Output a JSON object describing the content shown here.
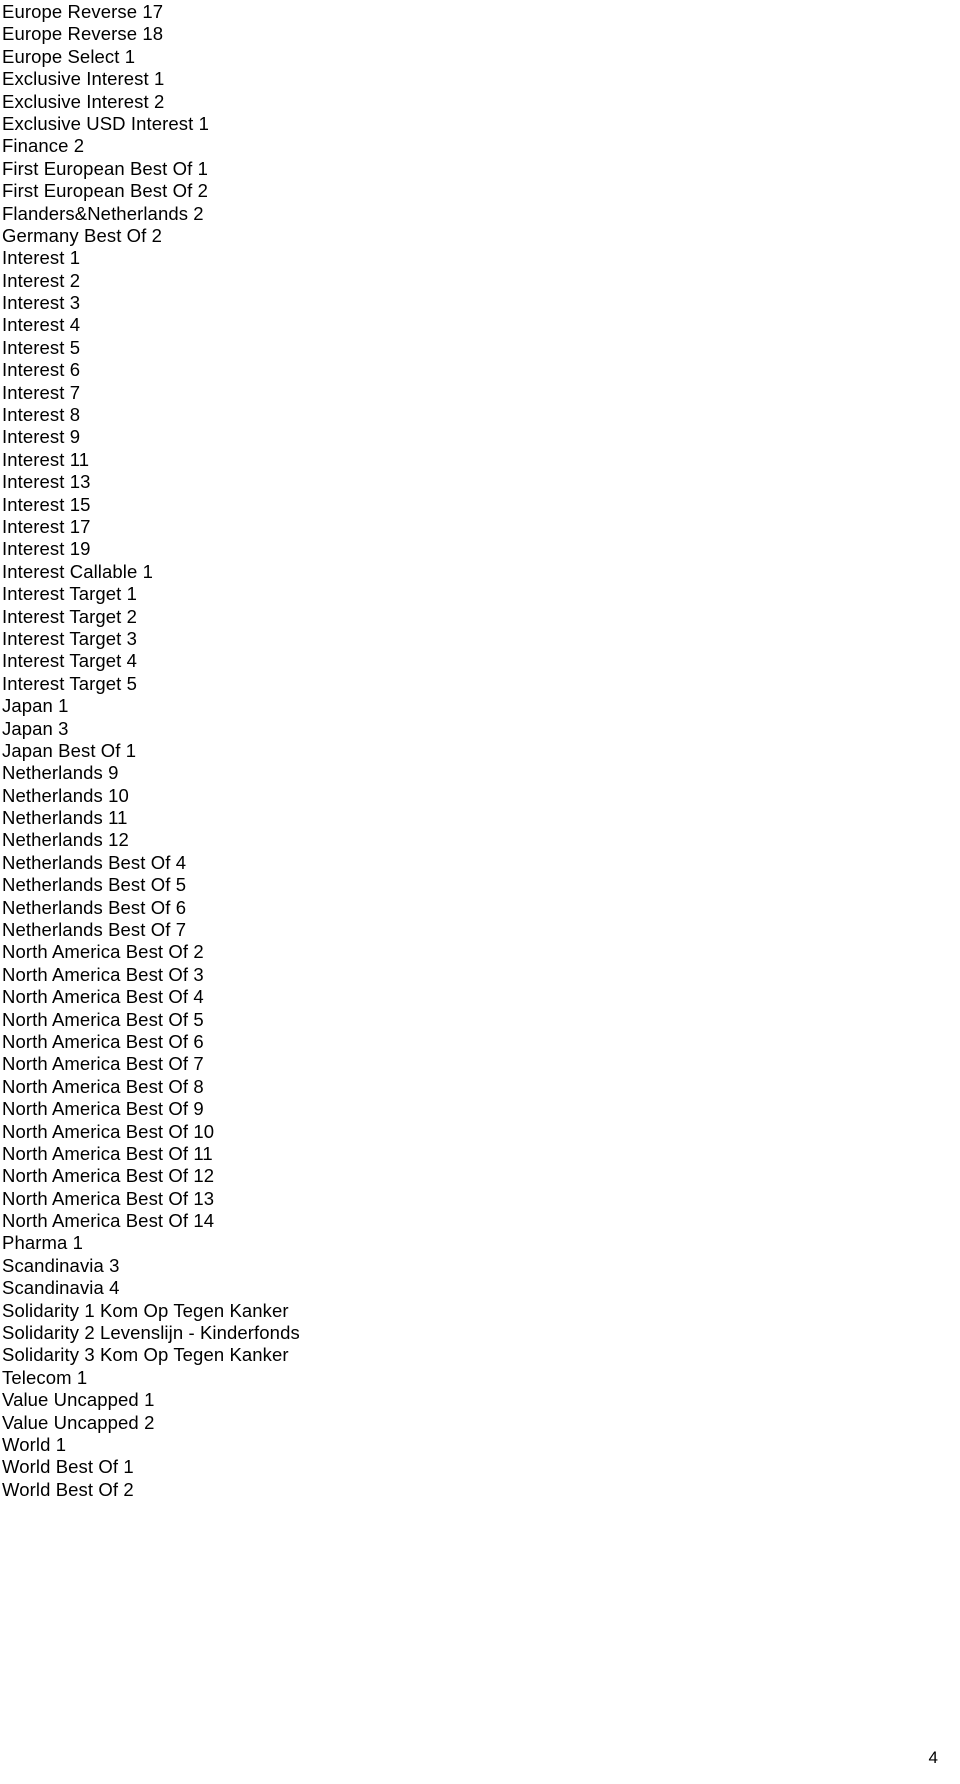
{
  "document": {
    "page_number": "4",
    "text_color": "#000000",
    "background_color": "#ffffff",
    "entries": [
      "Europe Reverse 17",
      "Europe Reverse 18",
      "Europe Select 1",
      "Exclusive Interest 1",
      "Exclusive Interest 2",
      "Exclusive USD Interest 1",
      "Finance 2",
      "First European Best Of 1",
      "First European Best Of 2",
      "Flanders&Netherlands 2",
      "Germany Best Of 2",
      "Interest 1",
      "Interest 2",
      "Interest 3",
      "Interest 4",
      "Interest 5",
      "Interest 6",
      "Interest 7",
      "Interest 8",
      "Interest 9",
      "Interest 11",
      "Interest 13",
      "Interest 15",
      "Interest 17",
      "Interest 19",
      "Interest Callable 1",
      "Interest Target 1",
      "Interest Target 2",
      "Interest Target 3",
      "Interest Target 4",
      "Interest Target 5",
      "Japan 1",
      "Japan 3",
      "Japan Best Of 1",
      "Netherlands 9",
      "Netherlands 10",
      "Netherlands 11",
      "Netherlands 12",
      "Netherlands Best Of 4",
      "Netherlands Best Of 5",
      "Netherlands Best Of 6",
      "Netherlands Best Of 7",
      "North America Best Of 2",
      "North America Best Of 3",
      "North America Best Of 4",
      "North America Best Of 5",
      "North America Best Of 6",
      "North America Best Of 7",
      "North America Best Of 8",
      "North America Best Of 9",
      "North America Best Of 10",
      "North America Best Of 11",
      "North America Best Of 12",
      "North America Best Of 13",
      "North America Best Of 14",
      "Pharma 1",
      "Scandinavia 3",
      "Scandinavia 4",
      "Solidarity 1 Kom Op Tegen Kanker",
      "Solidarity 2 Levenslijn - Kinderfonds",
      "Solidarity 3 Kom Op Tegen Kanker",
      "Telecom 1",
      "Value Uncapped 1",
      "Value Uncapped 2",
      "World 1",
      "World Best Of 1",
      "World Best Of 2"
    ]
  }
}
